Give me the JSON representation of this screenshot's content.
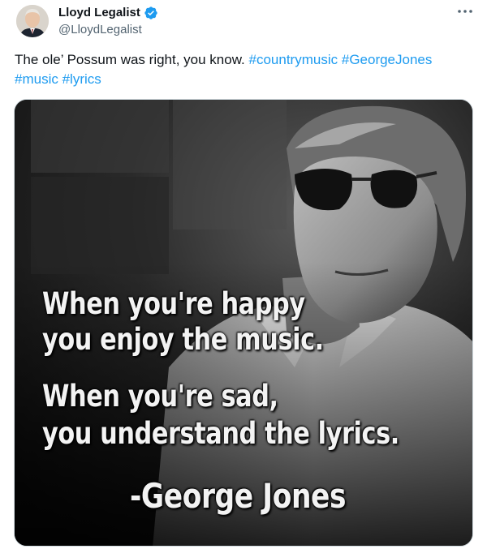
{
  "tweet": {
    "author": {
      "display_name": "Lloyd Legalist",
      "handle": "@LloydLegalist",
      "verified": true,
      "verified_color": "#1d9bf0"
    },
    "more_icon": "more-horizontal-icon",
    "text": {
      "body": "The ole’ Possum was right, you know.",
      "hashtags": [
        "#countrymusic",
        "#GeorgeJones",
        "#music",
        "#lyrics"
      ],
      "hashtag_color": "#1d9bf0"
    },
    "media": {
      "quote_lines": [
        "When you're happy",
        "you enjoy the music.",
        "When you're sad,",
        "you understand the lyrics."
      ],
      "attribution": "-George Jones"
    }
  }
}
